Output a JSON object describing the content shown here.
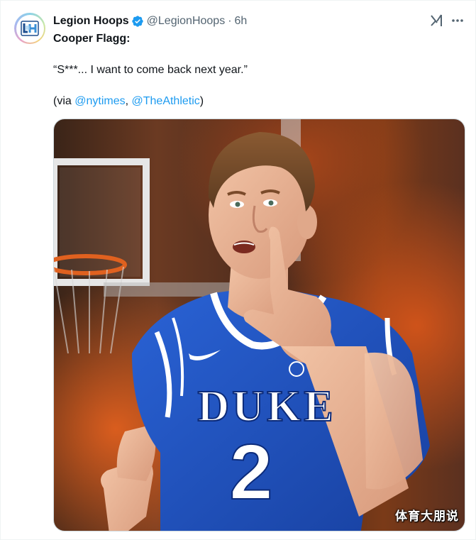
{
  "tweet": {
    "author": {
      "display_name": "Legion Hoops",
      "handle": "@LegionHoops",
      "separator": "·",
      "time": "6h",
      "verified": true,
      "avatar_icon": "legion-hoops-logo"
    },
    "line1": {
      "text": "Cooper Flagg:"
    },
    "quote": "“S***... I want to come back next year.”",
    "source": {
      "prefix": "(via ",
      "link1": "@nytimes",
      "comma": ", ",
      "link2": "@TheAthletic",
      "suffix": ")"
    },
    "media": {
      "jersey_text": "DUKE",
      "jersey_number": "2"
    },
    "icons": {
      "grok": "grok-icon",
      "more": "more-icon"
    }
  },
  "watermark": "体育大朋说",
  "colors": {
    "link": "#1d9bf0",
    "verified": "#1d9bf0",
    "muted": "#536471",
    "jersey_blue": "#1f53c4"
  }
}
